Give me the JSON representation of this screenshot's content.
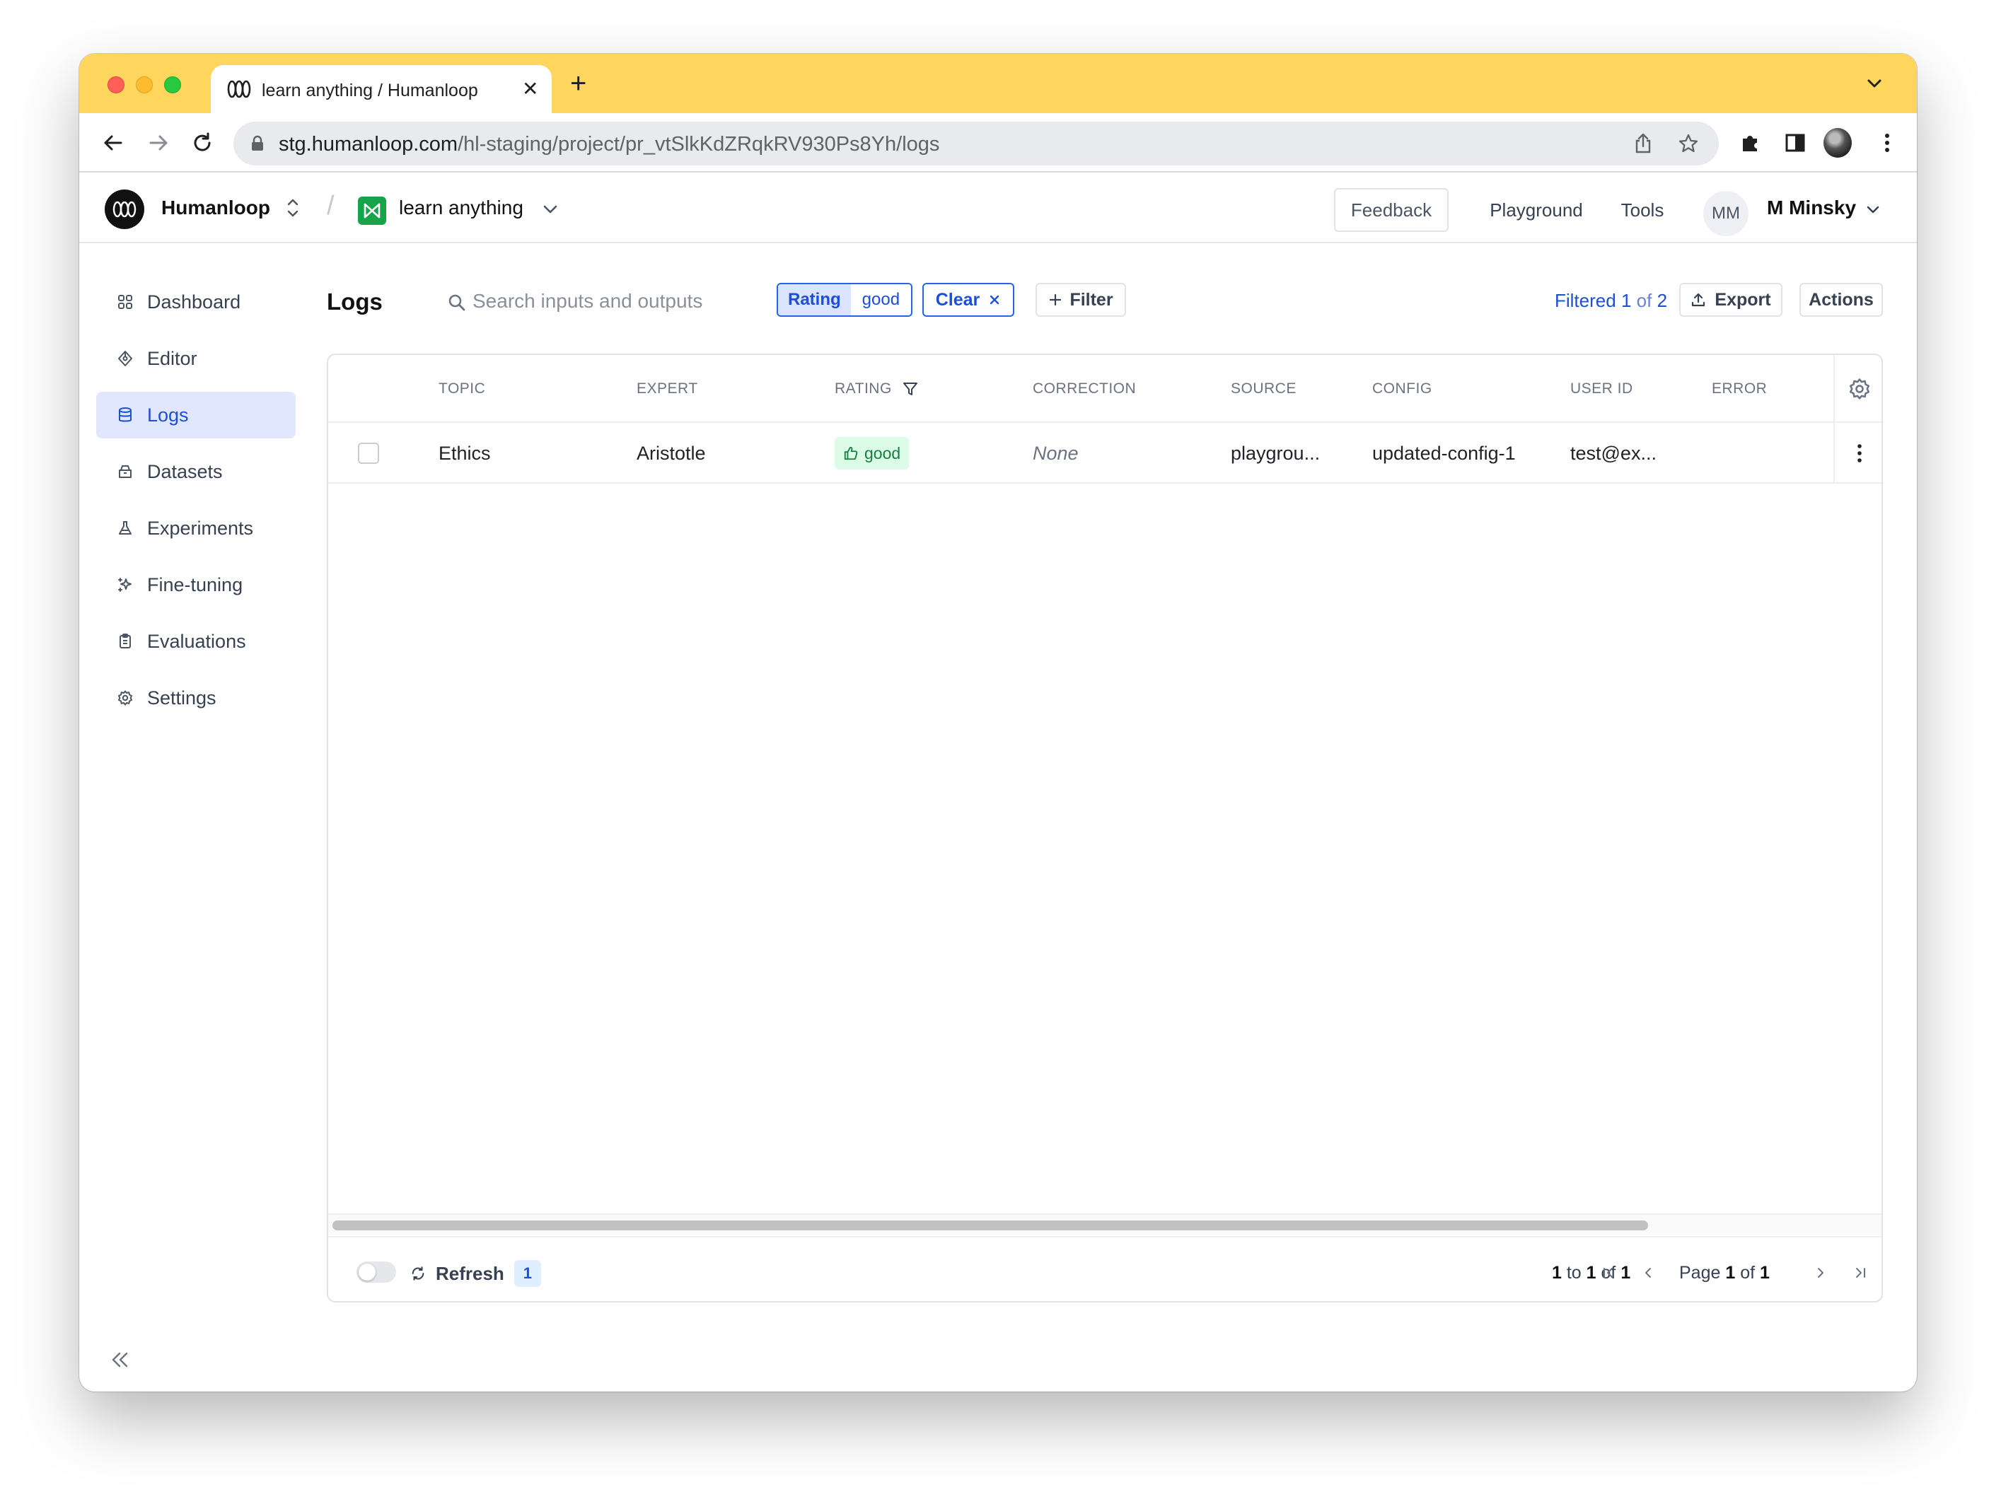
{
  "browser": {
    "tab_title": "learn anything / Humanloop",
    "url_host": "stg.humanloop.com",
    "url_path": "/hl-staging/project/pr_vtSlkKdZRqkRV930Ps8Yh/logs"
  },
  "header": {
    "org_name": "Humanloop",
    "project_name": "learn anything",
    "feedback_label": "Feedback",
    "playground_label": "Playground",
    "tools_label": "Tools",
    "user_initials": "MM",
    "user_name": "M Minsky"
  },
  "sidebar": {
    "items": [
      {
        "label": "Dashboard",
        "icon": "dashboard-icon"
      },
      {
        "label": "Editor",
        "icon": "editor-icon"
      },
      {
        "label": "Logs",
        "icon": "database-icon",
        "active": true
      },
      {
        "label": "Datasets",
        "icon": "datasets-icon"
      },
      {
        "label": "Experiments",
        "icon": "flask-icon"
      },
      {
        "label": "Fine-tuning",
        "icon": "sparkle-icon"
      },
      {
        "label": "Evaluations",
        "icon": "clipboard-icon"
      },
      {
        "label": "Settings",
        "icon": "gear-icon"
      }
    ]
  },
  "main": {
    "title": "Logs",
    "search_placeholder": "Search inputs and outputs",
    "filter_chip": {
      "key": "Rating",
      "value": "good"
    },
    "clear_label": "Clear",
    "filter_label": "Filter",
    "filtered": {
      "prefix": "Filtered",
      "shown": "1",
      "of": "of",
      "total": "2"
    },
    "export_label": "Export",
    "actions_label": "Actions"
  },
  "table": {
    "columns": [
      "TOPIC",
      "EXPERT",
      "RATING",
      "CORRECTION",
      "SOURCE",
      "CONFIG",
      "USER ID",
      "ERROR"
    ],
    "rows": [
      {
        "topic": "Ethics",
        "expert": "Aristotle",
        "rating": "good",
        "correction": "None",
        "source": "playgrou...",
        "config": "updated-config-1",
        "user_id": "test@ex...",
        "error": ""
      }
    ]
  },
  "footer": {
    "refresh_label": "Refresh",
    "refresh_count": "1",
    "range": {
      "from": "1",
      "to_word": "to",
      "to": "1",
      "of_word": "of",
      "total": "1"
    },
    "page": {
      "label": "Page",
      "current": "1",
      "of_word": "of",
      "total": "1"
    }
  },
  "colors": {
    "tabbar": "#fed65e",
    "accent": "#2563eb",
    "active_nav_bg": "#e0e7ff",
    "good_badge_bg": "#dcfce7",
    "good_badge_text": "#15803d"
  }
}
